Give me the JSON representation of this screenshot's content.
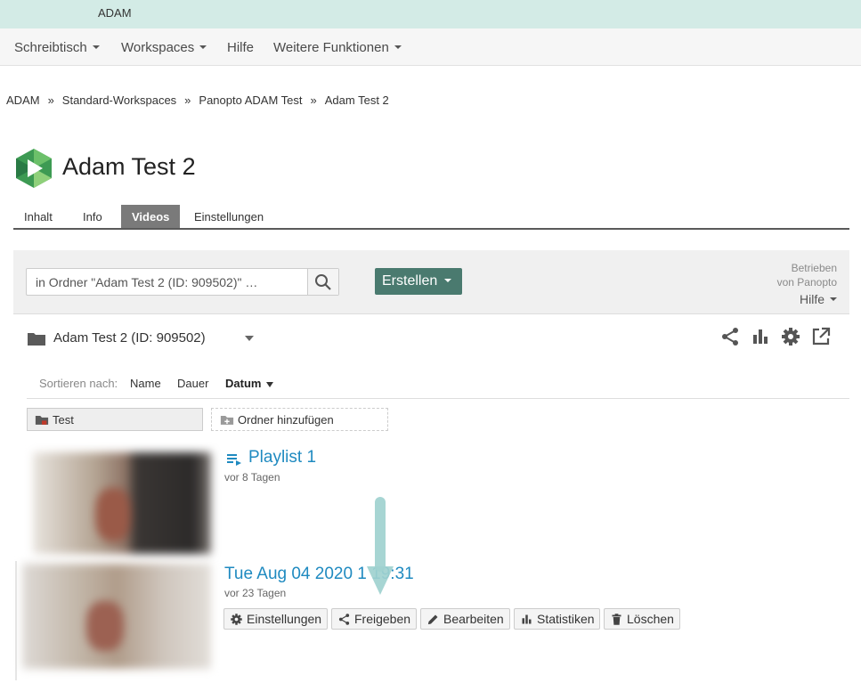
{
  "topbar": {
    "app_name": "ADAM"
  },
  "nav": [
    {
      "label": "Schreibtisch",
      "dropdown": true
    },
    {
      "label": "Workspaces",
      "dropdown": true
    },
    {
      "label": "Hilfe",
      "dropdown": false
    },
    {
      "label": "Weitere Funktionen",
      "dropdown": true
    }
  ],
  "breadcrumb": [
    "ADAM",
    "Standard-Workspaces",
    "Panopto ADAM Test",
    "Adam Test 2"
  ],
  "breadcrumb_separator": "»",
  "page_title": "Adam Test 2",
  "tabs": [
    {
      "label": "Inhalt",
      "active": false
    },
    {
      "label": "Info",
      "active": false
    },
    {
      "label": "Videos",
      "active": true
    },
    {
      "label": "Einstellungen",
      "active": false
    }
  ],
  "toolbar": {
    "search_value": "in Ordner \"Adam Test 2 (ID: 909502)\" …",
    "create_label": "Erstellen",
    "powered_line1": "Betrieben",
    "powered_line2": "von Panopto",
    "help_label": "Hilfe"
  },
  "folder": {
    "name": "Adam Test 2 (ID: 909502)"
  },
  "sort": {
    "label": "Sortieren nach:",
    "options": [
      "Name",
      "Dauer",
      "Datum"
    ],
    "active": "Datum"
  },
  "subfolders": [
    {
      "name": "Test"
    }
  ],
  "add_folder_label": "Ordner hinzufügen",
  "sessions": [
    {
      "title": "Playlist 1",
      "age": "vor 8 Tagen",
      "type": "playlist"
    },
    {
      "title": "Tue Aug 04 2020 1  19:31",
      "age": "vor 23 Tagen",
      "type": "video"
    }
  ],
  "session_buttons": [
    {
      "label": "Einstellungen",
      "icon": "gear-icon"
    },
    {
      "label": "Freigeben",
      "icon": "share-icon"
    },
    {
      "label": "Bearbeiten",
      "icon": "pencil-icon"
    },
    {
      "label": "Statistiken",
      "icon": "bar-chart-icon"
    },
    {
      "label": "Löschen",
      "icon": "trash-icon"
    }
  ],
  "colors": {
    "topbar_bg": "#d3ebe6",
    "create_button": "#4a7a6f",
    "link_blue": "#1f8ac0",
    "annotation_arrow": "#9fd1cf"
  }
}
